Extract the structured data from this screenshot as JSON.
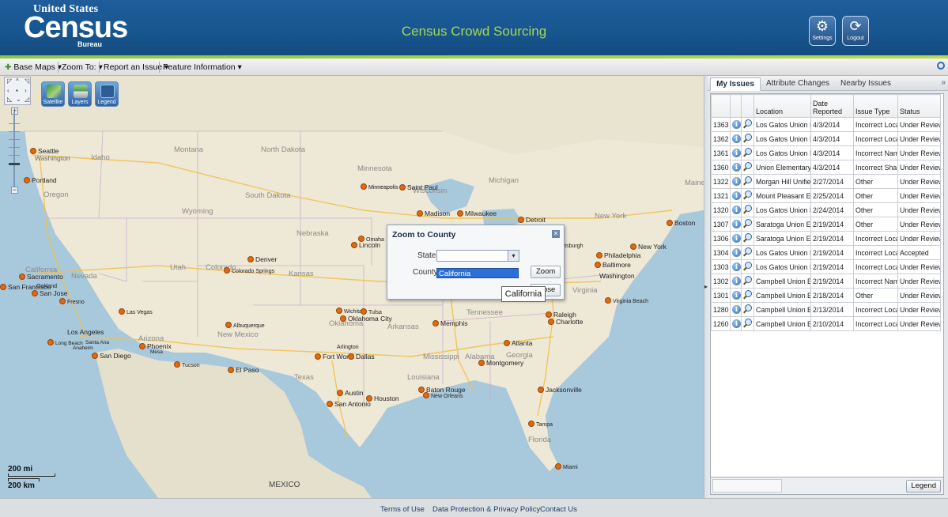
{
  "header": {
    "logo_top": "United States",
    "logo_main": "Census",
    "logo_bottom": "Bureau",
    "title": "Census Crowd Sourcing",
    "settings_label": "Settings",
    "logout_label": "Logout",
    "accent_color": "#8cc63f",
    "title_color": "#a6d857"
  },
  "toolbar": {
    "items": [
      "Base Maps",
      "Zoom To:",
      "Report an Issue",
      "Feature Information"
    ]
  },
  "map_tools": {
    "satellite": "Satellite",
    "layers": "Layers",
    "legend": "Legend"
  },
  "map_labels": {
    "states": [
      "Montana",
      "North Dakota",
      "Minnesota",
      "Idaho",
      "Oregon",
      "South Dakota",
      "Wisconsin",
      "Michigan",
      "Wyoming",
      "Nebraska",
      "Iowa",
      "California",
      "Nevada",
      "Utah",
      "Colorado",
      "Kansas",
      "Missouri",
      "Arizona",
      "New Mexico",
      "Oklahoma",
      "Arkansas",
      "Tennessee",
      "Mississippi",
      "Alabama",
      "Georgia",
      "Texas",
      "Louisiana",
      "Florida",
      "New York",
      "Virginia",
      "Maine"
    ],
    "country": "MEXICO",
    "cities": [
      "Seattle",
      "Washington",
      "Portland",
      "Minneapolis",
      "Saint Paul",
      "Madison",
      "Milwaukee",
      "Detroit",
      "Boston",
      "New York",
      "Philadelphia",
      "Baltimore",
      "Washington",
      "Pittsburgh",
      "Denver",
      "Colorado Springs",
      "Omaha",
      "Lincoln",
      "Sacramento",
      "San Francisco",
      "Oakland",
      "San Jose",
      "Fresno",
      "Las Vegas",
      "Los Angeles",
      "Long Beach",
      "Santa Ana",
      "Anaheim",
      "San Diego",
      "Phoenix",
      "Mesa",
      "Tucson",
      "Albuquerque",
      "El Paso",
      "Wichita",
      "Tulsa",
      "Oklahoma City",
      "Arlington",
      "Fort Worth",
      "Dallas",
      "Austin",
      "San Antonio",
      "Houston",
      "Memphis",
      "Atlanta",
      "Montgomery",
      "Baton Rouge",
      "New Orleans",
      "Raleigh",
      "Charlotte",
      "Virginia Beach",
      "Jacksonville",
      "Tampa",
      "Miami"
    ]
  },
  "scale": {
    "miles": "200 mi",
    "km": "200 km"
  },
  "dialog": {
    "title": "Zoom to County",
    "state_label": "State",
    "county_label": "County",
    "county_selected": "California",
    "zoom_button": "Zoom",
    "close_button": "Close",
    "tooltip": "California"
  },
  "panel": {
    "tabs": [
      "My Issues",
      "Attribute Changes",
      "Nearby Issues"
    ],
    "active_tab": "My Issues",
    "columns": [
      "",
      "",
      "",
      "Location",
      "Date Reported",
      "Issue Type",
      "Status"
    ],
    "rows": [
      {
        "id": "1363",
        "location": "Los Gatos Union Ele",
        "date": "4/3/2014",
        "type": "Incorrect Loca",
        "status": "Under Review"
      },
      {
        "id": "1362",
        "location": "Los Gatos Union Ele",
        "date": "4/3/2014",
        "type": "Incorrect Loca",
        "status": "Under Review"
      },
      {
        "id": "1361",
        "location": "Los Gatos Union Ele",
        "date": "4/3/2014",
        "type": "Incorrect Nam",
        "status": "Under Review"
      },
      {
        "id": "1360",
        "location": "Union Elementary S",
        "date": "4/3/2014",
        "type": "Incorrect Shap",
        "status": "Under Review"
      },
      {
        "id": "1322",
        "location": "Morgan Hill Unified",
        "date": "2/27/2014",
        "type": "Other",
        "status": "Under Review"
      },
      {
        "id": "1321",
        "location": "Mount Pleasant Ele",
        "date": "2/25/2014",
        "type": "Other",
        "status": "Under Review"
      },
      {
        "id": "1320",
        "location": "Los Gatos Union Ele",
        "date": "2/24/2014",
        "type": "Other",
        "status": "Under Review"
      },
      {
        "id": "1307",
        "location": "Saratoga Union Ele",
        "date": "2/19/2014",
        "type": "Other",
        "status": "Under Review"
      },
      {
        "id": "1306",
        "location": "Saratoga Union Ele",
        "date": "2/19/2014",
        "type": "Incorrect Loca",
        "status": "Under Review"
      },
      {
        "id": "1304",
        "location": "Los Gatos Union Ele",
        "date": "2/19/2014",
        "type": "Incorrect Loca",
        "status": "Accepted"
      },
      {
        "id": "1303",
        "location": "Los Gatos Union Ele",
        "date": "2/19/2014",
        "type": "Incorrect Loca",
        "status": "Under Review"
      },
      {
        "id": "1302",
        "location": "Campbell Union Ele",
        "date": "2/19/2014",
        "type": "Incorrect Nam",
        "status": "Under Review"
      },
      {
        "id": "1301",
        "location": "Campbell Union Ele",
        "date": "2/18/2014",
        "type": "Other",
        "status": "Under Review"
      },
      {
        "id": "1280",
        "location": "Campbell Union Ele",
        "date": "2/13/2014",
        "type": "Incorrect Loca",
        "status": "Under Review"
      },
      {
        "id": "1260",
        "location": "Campbell Union Ele",
        "date": "2/10/2014",
        "type": "Incorrect Loca",
        "status": "Under Review"
      }
    ],
    "legend_button": "Legend"
  },
  "footer": {
    "links": [
      "Terms of Use",
      "Data Protection & Privacy Policy",
      "Contact Us"
    ]
  }
}
